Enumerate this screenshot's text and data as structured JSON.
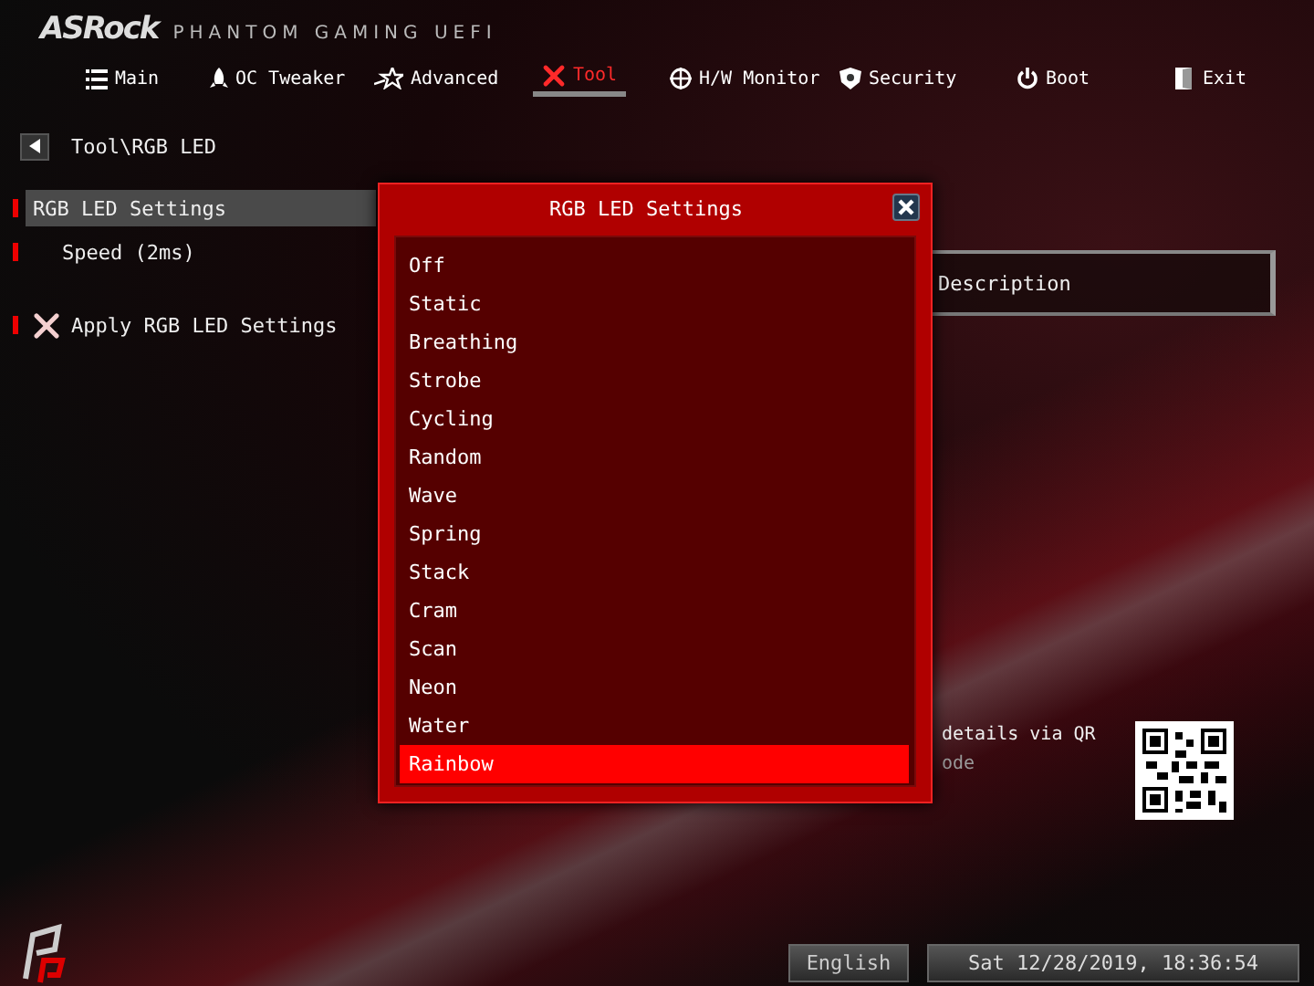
{
  "brand": {
    "logo": "ASRock",
    "product": "PHANTOM GAMING UEFI"
  },
  "tabs": [
    {
      "label": "Main",
      "selected": false
    },
    {
      "label": "OC Tweaker",
      "selected": false
    },
    {
      "label": "Advanced",
      "selected": false
    },
    {
      "label": "Tool",
      "selected": true
    },
    {
      "label": "H/W Monitor",
      "selected": false
    },
    {
      "label": "Security",
      "selected": false
    },
    {
      "label": "Boot",
      "selected": false
    },
    {
      "label": "Exit",
      "selected": false
    }
  ],
  "breadcrumb": "Tool\\RGB LED",
  "menu": [
    {
      "label": "RGB LED Settings",
      "kind": "item",
      "indent": false,
      "selected": true
    },
    {
      "label": "Speed (2ms)",
      "kind": "item",
      "indent": true,
      "selected": false
    },
    {
      "label": "Apply RGB LED Settings",
      "kind": "action",
      "indent": false,
      "selected": false
    }
  ],
  "description": {
    "title": "Description",
    "help": "details via QR",
    "help_2": "ode"
  },
  "dialog": {
    "title": "RGB LED Settings",
    "options": [
      {
        "label": "Off",
        "selected": false
      },
      {
        "label": "Static",
        "selected": false
      },
      {
        "label": "Breathing",
        "selected": false
      },
      {
        "label": "Strobe",
        "selected": false
      },
      {
        "label": "Cycling",
        "selected": false
      },
      {
        "label": "Random",
        "selected": false
      },
      {
        "label": "Wave",
        "selected": false
      },
      {
        "label": "Spring",
        "selected": false
      },
      {
        "label": "Stack",
        "selected": false
      },
      {
        "label": "Cram",
        "selected": false
      },
      {
        "label": "Scan",
        "selected": false
      },
      {
        "label": "Neon",
        "selected": false
      },
      {
        "label": "Water",
        "selected": false
      },
      {
        "label": "Rainbow",
        "selected": true
      }
    ]
  },
  "footer": {
    "language": "English",
    "datetime": "Sat 12/28/2019, 18:36:54"
  }
}
